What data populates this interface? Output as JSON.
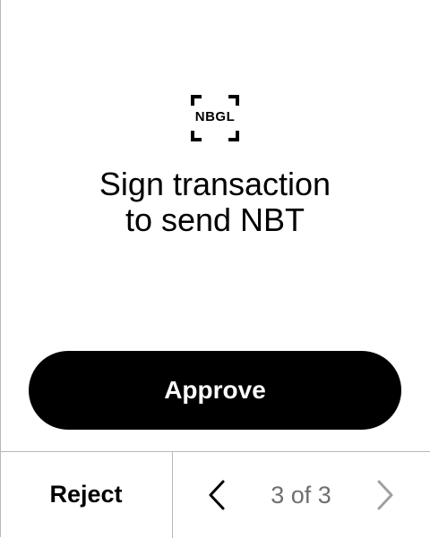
{
  "logo": {
    "text": "NBGL",
    "icon": "nbgl-bracket-logo-icon"
  },
  "review": {
    "title_line1": "Sign transaction",
    "title_line2": "to send NBT"
  },
  "actions": {
    "approve_label": "Approve",
    "reject_label": "Reject"
  },
  "navigation": {
    "page_indicator": "3 of 3",
    "current_page": 3,
    "total_pages": 3,
    "prev_icon": "chevron-left-icon",
    "next_icon": "chevron-right-icon",
    "prev_enabled": true,
    "next_enabled": false
  },
  "colors": {
    "primary": "#000000",
    "background": "#ffffff",
    "divider": "#b8b8b8",
    "muted_text": "#6f6f6f",
    "disabled_icon": "#a0a0a0"
  }
}
